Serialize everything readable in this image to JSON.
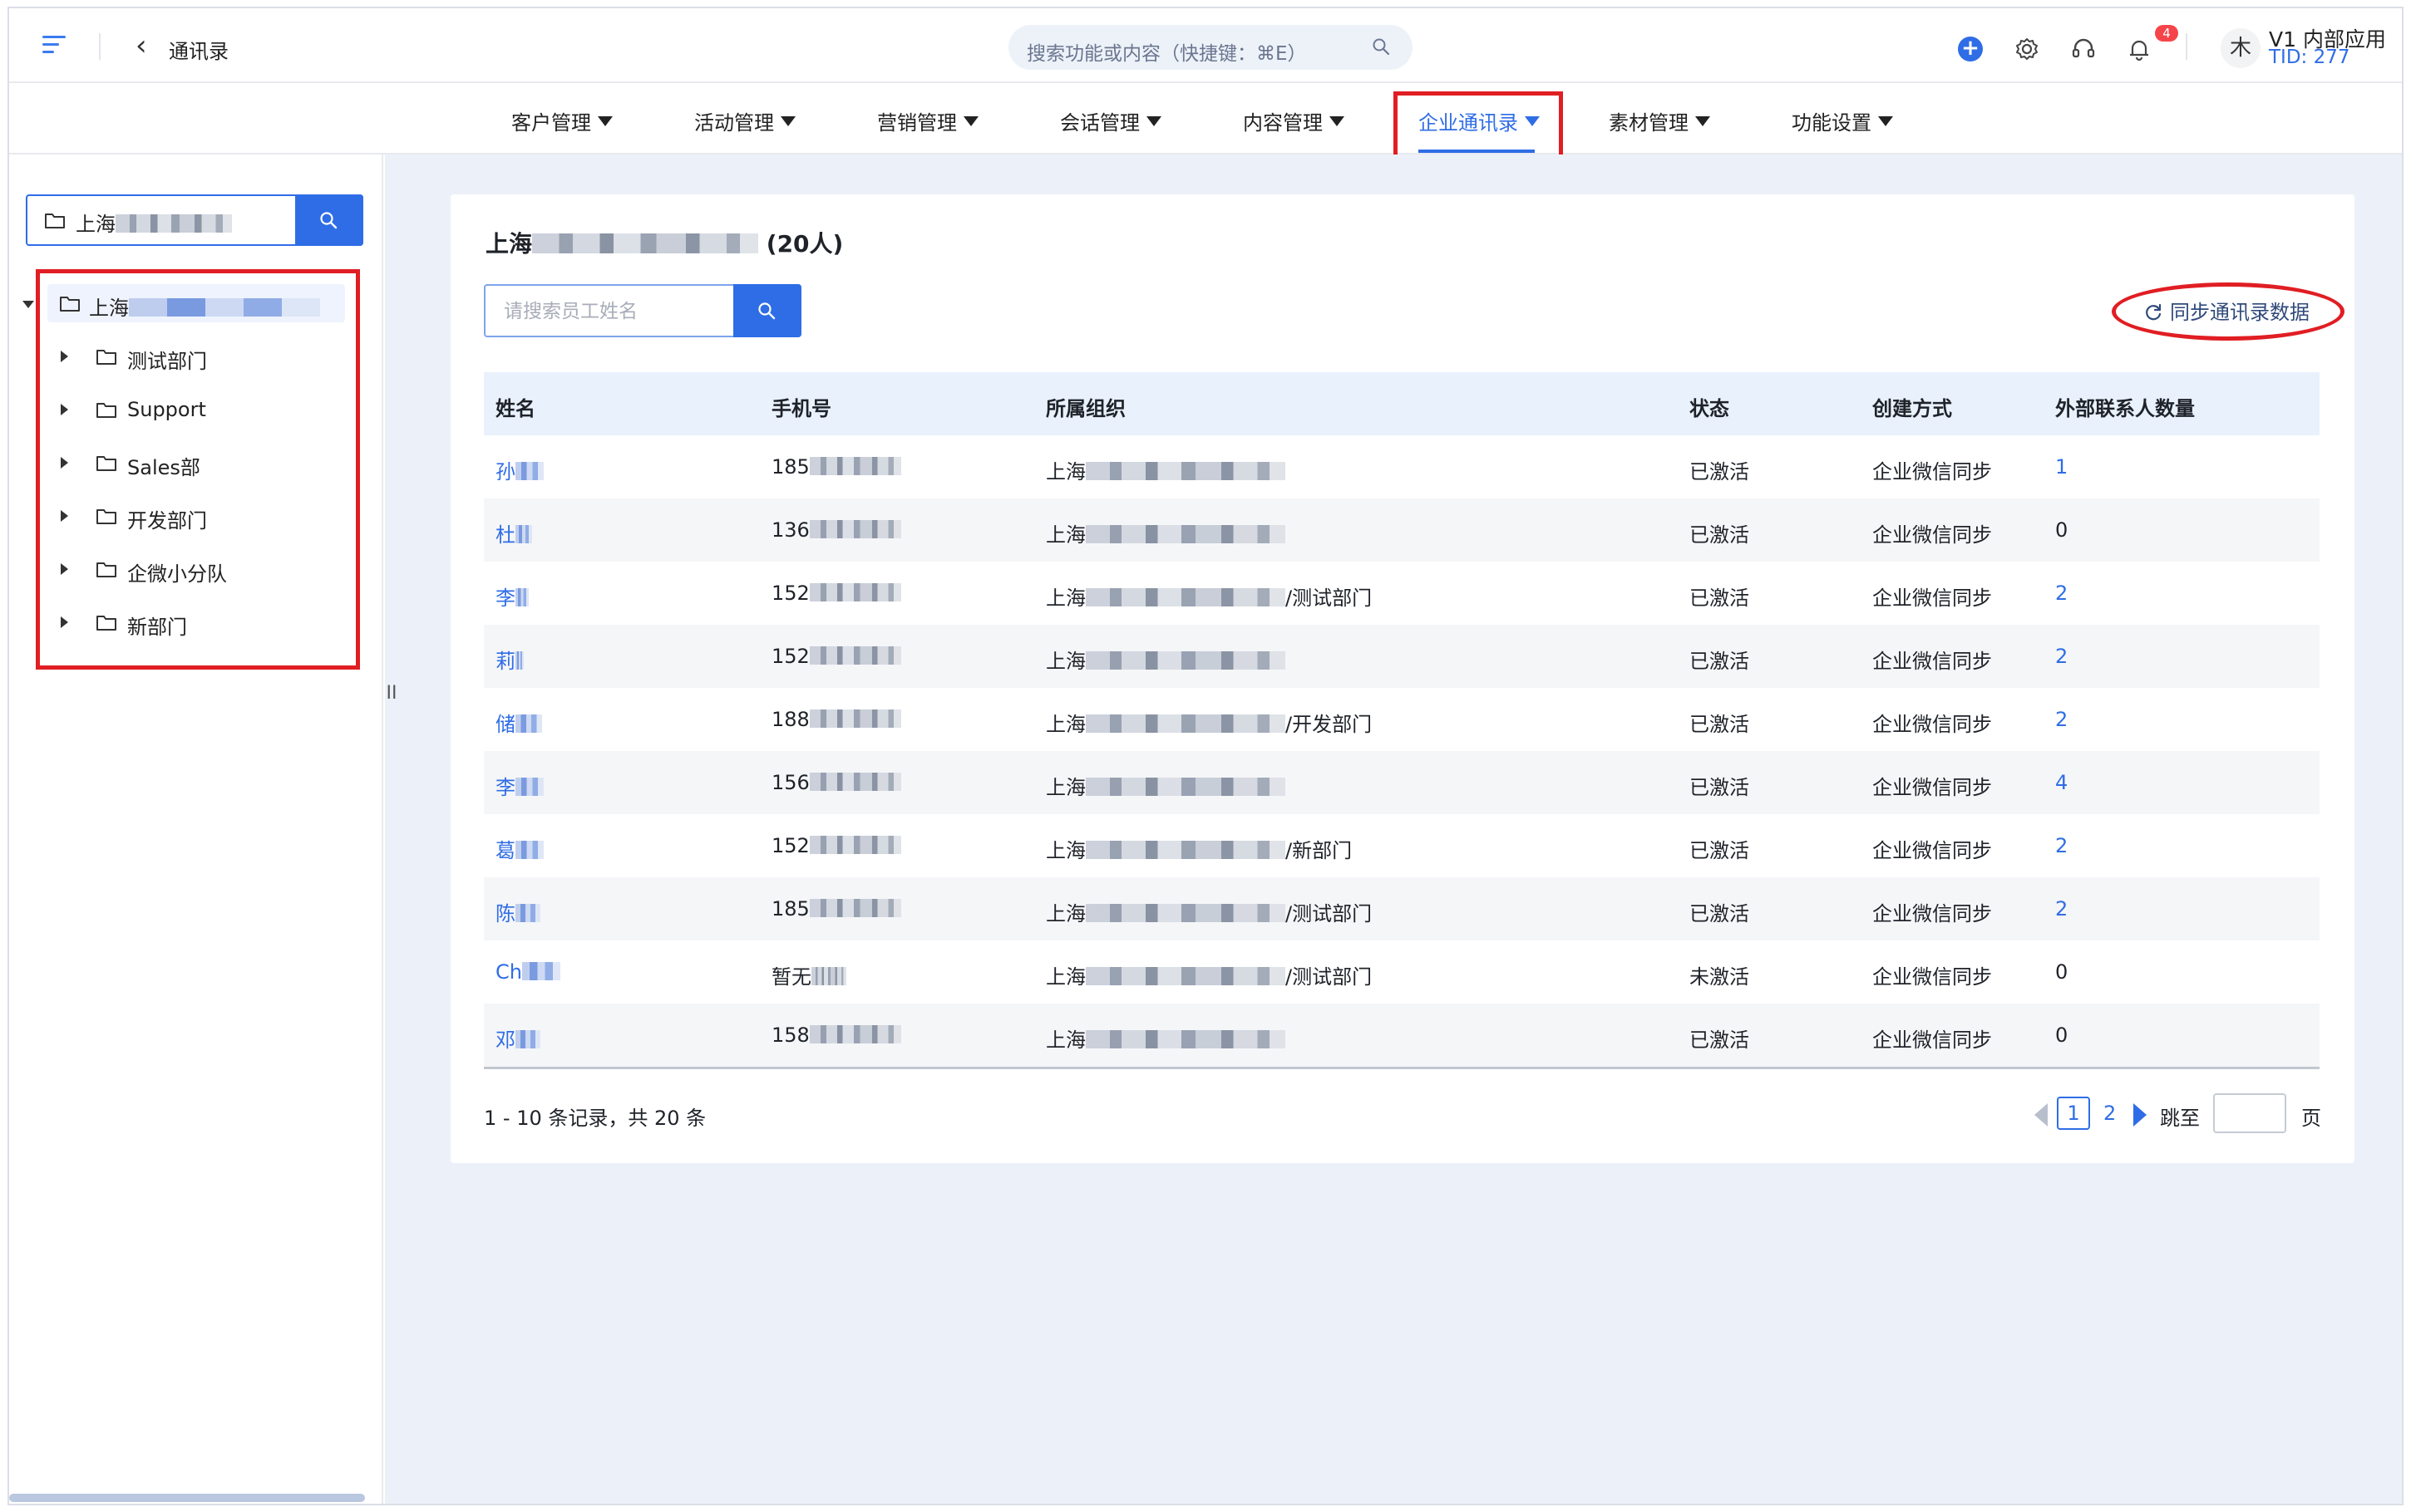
{
  "topbar": {
    "title": "通讯录",
    "search_placeholder": "搜索功能或内容（快捷键：⌘E）",
    "notification_count": "4",
    "avatar_char": "木",
    "app_name": "V1 内部应用",
    "tid": "TID: 277"
  },
  "nav": [
    {
      "label": "客户管理",
      "active": false
    },
    {
      "label": "活动管理",
      "active": false
    },
    {
      "label": "营销管理",
      "active": false
    },
    {
      "label": "会话管理",
      "active": false
    },
    {
      "label": "内容管理",
      "active": false
    },
    {
      "label": "企业通讯录",
      "active": true
    },
    {
      "label": "素材管理",
      "active": false
    },
    {
      "label": "功能设置",
      "active": false
    }
  ],
  "sidebar": {
    "search_value": "上海",
    "root_label": "上海",
    "departments": [
      "测试部门",
      "Support",
      "Sales部",
      "开发部门",
      "企微小分队",
      "新部门"
    ],
    "collapse_handle": "II"
  },
  "main": {
    "title_prefix": "上海",
    "title_suffix": "(20人)",
    "search_placeholder": "请搜索员工姓名",
    "sync_label": "同步通讯录数据",
    "columns": [
      "姓名",
      "手机号",
      "所属组织",
      "状态",
      "创建方式",
      "外部联系人数量"
    ],
    "rows": [
      {
        "name": "孙",
        "phone": "185",
        "org": "上海",
        "org_suffix": "",
        "status": "已激活",
        "method": "企业微信同步",
        "contacts": "1"
      },
      {
        "name": "杜",
        "phone": "136",
        "org": "上海",
        "org_suffix": "",
        "status": "已激活",
        "method": "企业微信同步",
        "contacts": "0"
      },
      {
        "name": "李",
        "phone": "152",
        "org": "上海",
        "org_suffix": "/测试部门",
        "status": "已激活",
        "method": "企业微信同步",
        "contacts": "2"
      },
      {
        "name": "莉",
        "phone": "152",
        "org": "上海",
        "org_suffix": "",
        "status": "已激活",
        "method": "企业微信同步",
        "contacts": "2"
      },
      {
        "name": "储",
        "phone": "188",
        "org": "上海",
        "org_suffix": "/开发部门",
        "status": "已激活",
        "method": "企业微信同步",
        "contacts": "2"
      },
      {
        "name": "李",
        "phone": "156",
        "org": "上海",
        "org_suffix": "",
        "status": "已激活",
        "method": "企业微信同步",
        "contacts": "4"
      },
      {
        "name": "葛",
        "phone": "152",
        "org": "上海",
        "org_suffix": "/新部门",
        "status": "已激活",
        "method": "企业微信同步",
        "contacts": "2"
      },
      {
        "name": "陈",
        "phone": "185",
        "org": "上海",
        "org_suffix": "/测试部门",
        "status": "已激活",
        "method": "企业微信同步",
        "contacts": "2"
      },
      {
        "name": "Ch",
        "phone": "暂无",
        "org": "上海",
        "org_suffix": "/测试部门",
        "status": "未激活",
        "method": "企业微信同步",
        "contacts": "0"
      },
      {
        "name": "邓",
        "phone": "158",
        "org": "上海",
        "org_suffix": "",
        "status": "已激活",
        "method": "企业微信同步",
        "contacts": "0"
      }
    ],
    "record_info": "1 - 10 条记录，共 20 条",
    "pagination": {
      "current": "1",
      "next_page": "2",
      "jump_label": "跳至",
      "page_unit": "页"
    }
  },
  "colors": {
    "accent": "#2f6de6",
    "highlight": "#e01e23",
    "main_bg": "#ecf1f9"
  }
}
